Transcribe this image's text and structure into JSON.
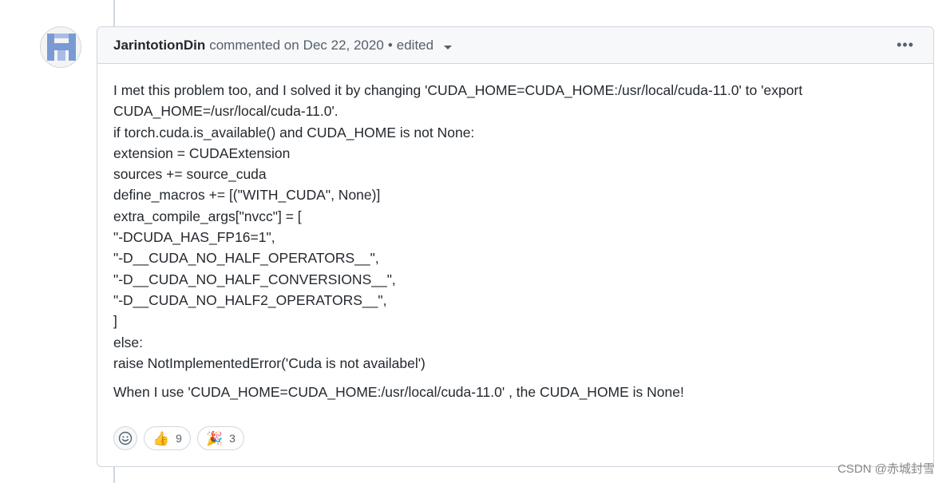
{
  "comment": {
    "author": "JarintotionDin",
    "action": "commented on",
    "date": "Dec 22, 2020",
    "separator": "•",
    "edited_label": "edited",
    "menu_glyph": "•••",
    "body_lines": [
      "I met this problem too, and I solved it by changing 'CUDA_HOME=CUDA_HOME:/usr/local/cuda-11.0' to 'export",
      "CUDA_HOME=/usr/local/cuda-11.0'.",
      "if torch.cuda.is_available() and CUDA_HOME is not None:",
      "extension = CUDAExtension",
      "sources += source_cuda",
      "define_macros += [(\"WITH_CUDA\", None)]",
      "extra_compile_args[\"nvcc\"] = [",
      "\"-DCUDA_HAS_FP16=1\",",
      "\"-D__CUDA_NO_HALF_OPERATORS__\",",
      "\"-D__CUDA_NO_HALF_CONVERSIONS__\",",
      "\"-D__CUDA_NO_HALF2_OPERATORS__\",",
      "]",
      "else:",
      "raise NotImplementedError('Cuda is not availabel')"
    ],
    "body_para2": "When I use 'CUDA_HOME=CUDA_HOME:/usr/local/cuda-11.0' , the CUDA_HOME is None!"
  },
  "reactions": [
    {
      "emoji": "👍",
      "icon": "thumbs-up-icon",
      "count": "9"
    },
    {
      "emoji": "🎉",
      "icon": "party-popper-icon",
      "count": "3"
    }
  ],
  "watermark": "CSDN @赤城封雪",
  "colors": {
    "header_bg": "#f6f8fa",
    "border": "#d0d7de",
    "muted_text": "#57606a",
    "avatar_color": "#7b9ad4"
  }
}
